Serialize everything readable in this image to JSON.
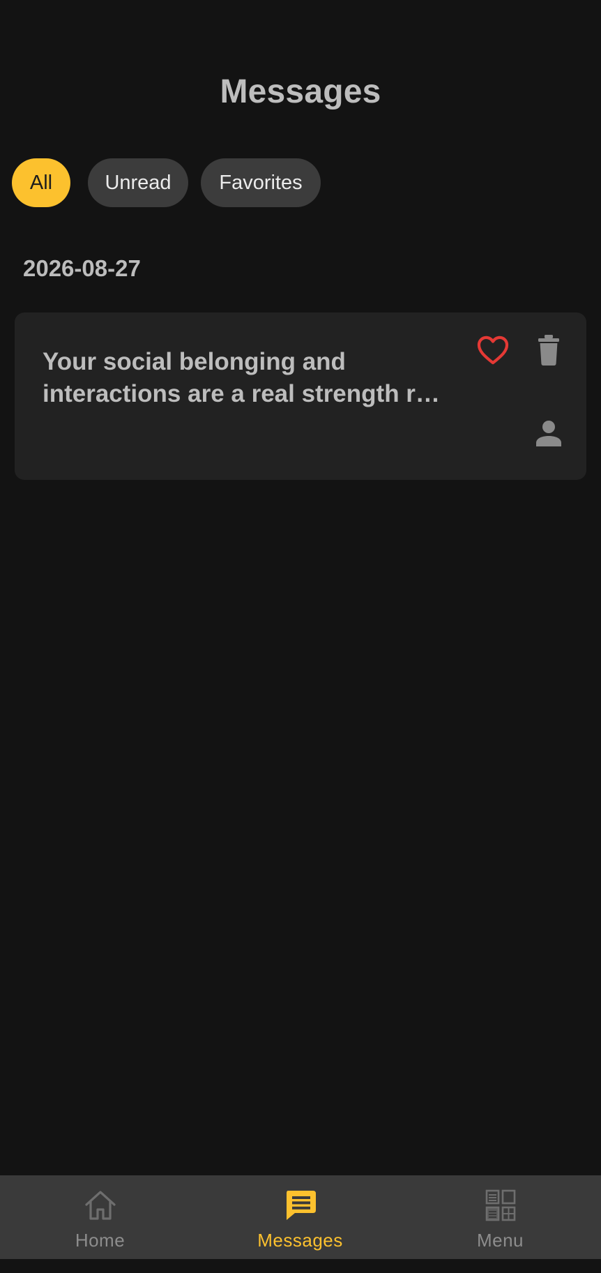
{
  "header": {
    "title": "Messages"
  },
  "filters": [
    {
      "label": "All",
      "selected": true
    },
    {
      "label": "Unread",
      "selected": false
    },
    {
      "label": "Favorites",
      "selected": false
    }
  ],
  "groups": [
    {
      "date": "2026-08-27",
      "messages": [
        {
          "preview": "Your social belonging and interactions are a real strength r…",
          "favorite_icon": "heart-outline-icon",
          "delete_icon": "trash-icon",
          "sender_icon": "person-icon"
        }
      ]
    }
  ],
  "bottom_nav": {
    "items": [
      {
        "label": "Home",
        "icon": "home-icon",
        "active": false
      },
      {
        "label": "Messages",
        "icon": "message-icon",
        "active": true
      },
      {
        "label": "Menu",
        "icon": "grid-menu-icon",
        "active": false
      }
    ]
  },
  "colors": {
    "background": "#131313",
    "accent": "#fcc12e",
    "card": "#222222",
    "favorite": "#e53935",
    "nav_background": "#3a3a3a"
  }
}
